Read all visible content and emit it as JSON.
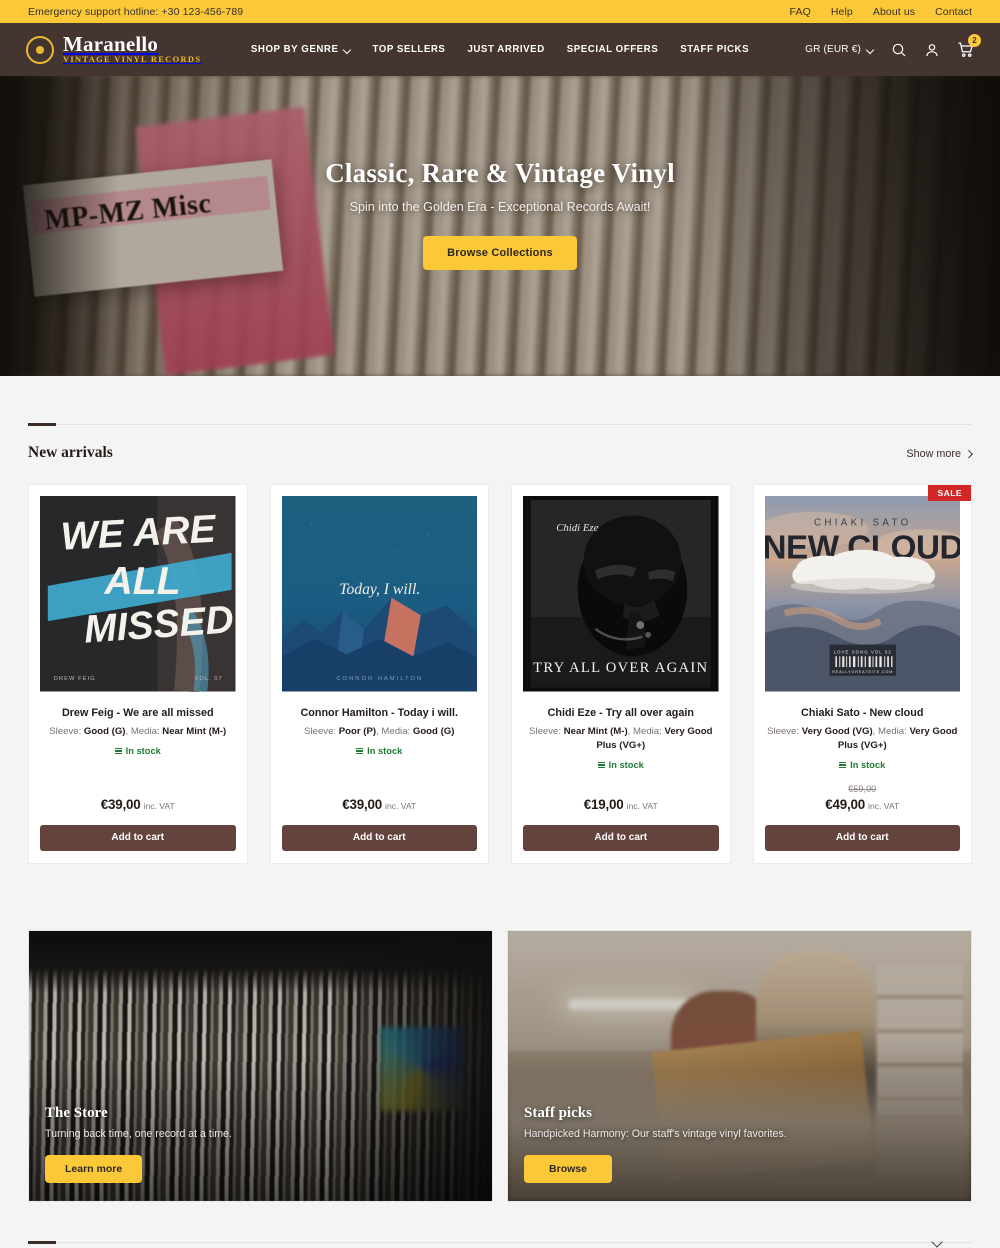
{
  "topbar": {
    "hotline": "Emergency support hotline: +30 123-456-789",
    "links": [
      "FAQ",
      "Help",
      "About us",
      "Contact"
    ]
  },
  "header": {
    "brand_name": "Maranello",
    "brand_tagline": "VINTAGE VINYL RECORDS",
    "nav": [
      {
        "label": "SHOP BY GENRE",
        "has_dropdown": true
      },
      {
        "label": "TOP SELLERS",
        "has_dropdown": false
      },
      {
        "label": "JUST ARRIVED",
        "has_dropdown": false
      },
      {
        "label": "SPECIAL OFFERS",
        "has_dropdown": false
      },
      {
        "label": "STAFF PICKS",
        "has_dropdown": false
      }
    ],
    "locale": "GR (EUR €)",
    "cart_count": "2"
  },
  "hero": {
    "title": "Classic, Rare & Vintage Vinyl",
    "subtitle": "Spin into the Golden Era - Exceptional Records Await!",
    "cta": "Browse Collections",
    "cover_label": "MP-MZ Misc"
  },
  "new_arrivals": {
    "title": "New arrivals",
    "show_more": "Show more",
    "products": [
      {
        "title": "Drew Feig - We are all missed",
        "sleeve_label": "Sleeve: ",
        "sleeve_value": "Good (G)",
        "media_label": ", Media: ",
        "media_value": "Near Mint (M-)",
        "stock": "In stock",
        "price": "€39,00",
        "old_price": "",
        "vat": "inc. VAT",
        "add_to_cart": "Add to cart",
        "badge": "",
        "cover": {
          "line1": "WE ARE",
          "line2": "ALL",
          "line3": "MISSED.",
          "artist": "DREW FEIG",
          "vol": "VOL. 07"
        }
      },
      {
        "title": "Connor Hamilton - Today i will.",
        "sleeve_label": "Sleeve: ",
        "sleeve_value": "Poor (P)",
        "media_label": ", Media: ",
        "media_value": "Good (G)",
        "stock": "In stock",
        "price": "€39,00",
        "old_price": "",
        "vat": "inc. VAT",
        "add_to_cart": "Add to cart",
        "badge": "",
        "cover": {
          "line1": "Today, I will.",
          "artist": "CONNOR HAMILTON"
        }
      },
      {
        "title": "Chidi Eze - Try all over again",
        "sleeve_label": "Sleeve: ",
        "sleeve_value": "Near Mint (M-)",
        "media_label": ", Media: ",
        "media_value": "Very Good Plus (VG+)",
        "stock": "In stock",
        "price": "€19,00",
        "old_price": "",
        "vat": "inc. VAT",
        "add_to_cart": "Add to cart",
        "badge": "",
        "cover": {
          "artist": "Chidi Eze",
          "line1": "TRY ALL OVER AGAIN"
        }
      },
      {
        "title": "Chiaki Sato - New cloud",
        "sleeve_label": "Sleeve: ",
        "sleeve_value": "Very Good (VG)",
        "media_label": ", Media: ",
        "media_value": "Very Good Plus (VG+)",
        "stock": "In stock",
        "price": "€49,00",
        "old_price": "€59,00",
        "vat": "inc. VAT",
        "add_to_cart": "Add to cart",
        "badge": "SALE",
        "cover": {
          "artist": "CHIAKI SATO",
          "line1": "NEW CLOUD",
          "barcode_top": "LOVE SONG VOL 02",
          "barcode_bottom": "REALLYGREATSITE.COM"
        }
      }
    ]
  },
  "promos": [
    {
      "title": "The Store",
      "subtitle": "Turning back time, one record at a time.",
      "cta": "Learn more"
    },
    {
      "title": "Staff picks",
      "subtitle": "Handpicked Harmony: Our staff's vintage vinyl favorites.",
      "cta": "Browse"
    }
  ],
  "colors": {
    "accent_yellow": "#fbc937",
    "header_brown": "#453531",
    "button_brown": "#63433c",
    "sale_red": "#d32626",
    "stock_green": "#1f7a34"
  }
}
